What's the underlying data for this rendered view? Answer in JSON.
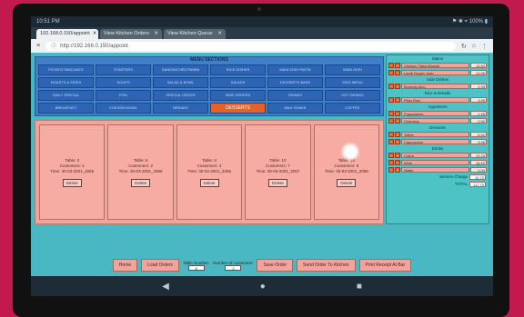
{
  "statusbar": {
    "left": "10:51 PM",
    "right": "⚑ ✱ ⌖ 100% ▮"
  },
  "tabs": [
    {
      "label": "192.168.0.150/appoint",
      "active": true
    },
    {
      "label": "View Kitchen Orders",
      "active": false
    },
    {
      "label": "View Kitchen Queue",
      "active": false
    }
  ],
  "url": "http://192.168.0.150/appoint",
  "menu": {
    "title": "MENU SECTIONS",
    "items": [
      "POTATO PANCAKES",
      "STARTERS",
      "SANDWICHES PANINI",
      "RICE DISHES",
      "MAIN DISH PASTA",
      "MAIN DISH",
      "ROASTS & SIDES",
      "SOUPS",
      "SALAD & BOWL",
      "SALADS",
      "DESSERTS BAKE",
      "KIDS MENU",
      "DAILY SPECIAL",
      "FISH",
      "SPECIAL ORDER",
      "SIDE ORDERS",
      "DRINKS",
      "HOT DRINKS",
      "BREAKFAST",
      "CHICKEN BOWL",
      "BREADS",
      "DESSERTS",
      "MILK SHAKE",
      "COFFEE"
    ],
    "active": "DESSERTS"
  },
  "tables": [
    {
      "title": "Table: 3",
      "customers": "Customers: 4",
      "time": "Time: 30-03-2001_2055",
      "action": "Delete"
    },
    {
      "title": "Table: 6",
      "customers": "Customers: 2",
      "time": "Time: 30-03-2001_2056",
      "action": "Delete"
    },
    {
      "title": "Table: 8",
      "customers": "Customers: 3",
      "time": "Time: 30-03-2001_2056",
      "action": "Delete"
    },
    {
      "title": "Table: 10",
      "customers": "Customers: 7",
      "time": "Time: 30-03-2001_2057",
      "action": "Delete"
    },
    {
      "title": "Table: 18",
      "customers": "Customers: 5",
      "time": "Time: 30-03-2001_2058",
      "action": "Delete"
    }
  ],
  "order": {
    "sections": [
      {
        "title": "Mains",
        "items": [
          {
            "name": "Chicken Tikka Masala",
            "price": "13.50"
          },
          {
            "name": "Lamb Rogan Josh",
            "price": "13.95"
          }
        ]
      },
      {
        "title": "Side Dishes",
        "items": [
          {
            "name": "Bombay Aloo",
            "price": "4.95"
          }
        ]
      },
      {
        "title": "Rice & Breads",
        "items": [
          {
            "name": "Pilau Rice",
            "price": "3.95"
          }
        ]
      },
      {
        "title": "Appetisers",
        "items": [
          {
            "name": "Poppadoms",
            "price": "1.95"
          },
          {
            "name": "Chutneys",
            "price": "2.50"
          }
        ]
      },
      {
        "title": "Desserts",
        "items": [
          {
            "name": "Toffee",
            "price": "5.50"
          },
          {
            "name": "Cappuccino",
            "price": "3.95"
          }
        ]
      },
      {
        "title": "Drinks",
        "items": [
          {
            "name": "Cobra",
            "price": "23.25"
          },
          {
            "name": "Wine",
            "price": "18.50"
          },
          {
            "name": "Water",
            "price": "2.00"
          }
        ]
      }
    ],
    "service_label": "Service Charge",
    "service_value": "10.70",
    "total_label": "TOTAL",
    "total_value": "117.70"
  },
  "bottombar": {
    "home": "Home",
    "load": "Load Orders",
    "table_label": "Table Number:",
    "table_value": "8",
    "customers_label": "Number of customers:",
    "customers_value": "3",
    "save": "Save Order",
    "send": "Send Order To Kitchen",
    "print": "Print Receipt At Bar"
  },
  "colors": {
    "page_bg": "#4ab8c2",
    "menu_bg": "#3f80c8",
    "accent": "#e7612a",
    "card": "#f7aca3"
  }
}
